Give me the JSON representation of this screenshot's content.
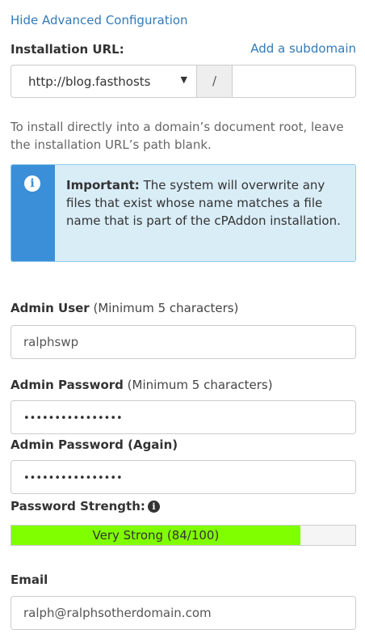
{
  "advanced_toggle": "Hide Advanced Configuration",
  "installation_url": {
    "label": "Installation URL:",
    "subdomain_link": "Add a subdomain",
    "domain_value": "http://blog.fasthosts",
    "separator": "/",
    "path_value": ""
  },
  "help_text": "To install directly into a domain’s document root, leave the installation URL’s path blank.",
  "callout": {
    "icon": "info-icon",
    "title": "Important:",
    "body": " The system will overwrite any files that exist whose name matches a file name that is part of the cPAddon installation."
  },
  "admin_user": {
    "label": "Admin User",
    "hint": " (Minimum 5 characters)",
    "value": "ralphswp"
  },
  "admin_password": {
    "label": "Admin Password",
    "hint": " (Minimum 5 characters)",
    "masked": "••••••••••••••••"
  },
  "admin_password_again": {
    "label": "Admin Password (Again)",
    "masked": "••••••••••••••••"
  },
  "password_strength": {
    "label": "Password Strength:",
    "text": "Very Strong (84/100)",
    "score": 84,
    "max": 100,
    "color": "#80ff00"
  },
  "email": {
    "label": "Email",
    "value": "ralph@ralphsotherdomain.com"
  },
  "colors": {
    "link": "#337ab7",
    "callout_bg": "#d9edf7",
    "callout_accent": "#3a8fd8"
  }
}
